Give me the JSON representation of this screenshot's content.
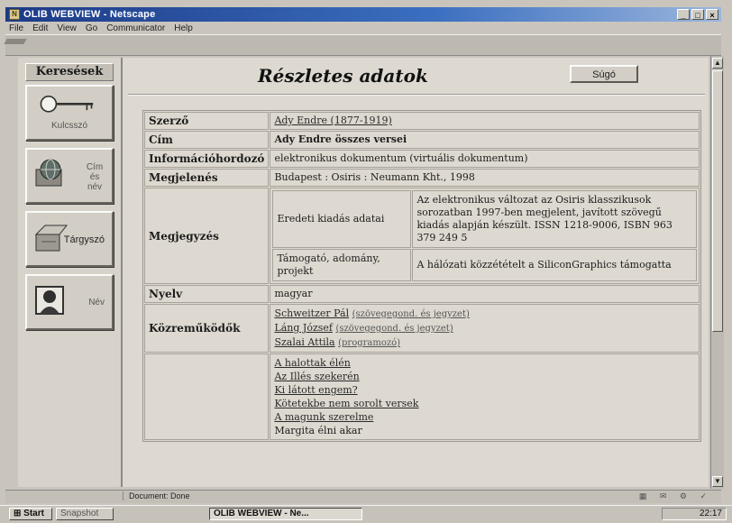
{
  "window": {
    "title": "OLIB WEBVIEW - Netscape",
    "controls": [
      "_",
      "□",
      "×"
    ]
  },
  "menu": [
    "File",
    "Edit",
    "View",
    "Go",
    "Communicator",
    "Help"
  ],
  "sidebar": {
    "heading": "Keresések",
    "items": [
      {
        "label": "Kulcsszó",
        "icon": "key-icon"
      },
      {
        "label": "Cím és név",
        "icon": "globe-book-icon"
      },
      {
        "label": "Tárgyszó",
        "icon": "open-box-icon"
      },
      {
        "label": "Név",
        "icon": "portrait-icon"
      }
    ]
  },
  "main": {
    "title": "Részletes adatok",
    "help_button": "Súgó",
    "rows": {
      "author": {
        "key": "Szerző",
        "value": "Ady Endre (1877-1919)"
      },
      "title": {
        "key": "Cím",
        "value": "Ady Endre összes versei"
      },
      "medium": {
        "key": "Információhordozó",
        "value": "elektronikus dokumentum (virtuális dokumentum)"
      },
      "published": {
        "key": "Megjelenés",
        "value": "Budapest : Osiris : Neumann Kht., 1998"
      },
      "note": {
        "key": "Megjegyzés",
        "entries": [
          {
            "label": "Eredeti kiadás adatai",
            "value": "Az elektronikus változat az Osiris klasszikusok sorozatban 1997-ben megjelent, javított szövegű kiadás alapján készült. ISSN 1218-9006, ISBN 963 379 249 5"
          },
          {
            "label": "Támogató, adomány, projekt",
            "value": "A hálózati közzétételt a SiliconGraphics támogatta"
          }
        ]
      },
      "language": {
        "key": "Nyelv",
        "value": "magyar"
      },
      "contributors": {
        "key": "Közreműködők",
        "items": [
          {
            "name": "Schweitzer Pál",
            "role": "(szövegegond. és jegyzet)"
          },
          {
            "name": "Láng József",
            "role": "(szövegegond. és jegyzet)"
          },
          {
            "name": "Szalai Attila",
            "role": "(programozó)"
          }
        ]
      },
      "contents": {
        "items": [
          "A halottak élén",
          "Az Illés szekerén",
          "Ki látott engem?",
          "Kötetekbe nem sorolt versek",
          "A magunk szerelme",
          "Margita élni akar"
        ]
      }
    }
  },
  "statusbar": {
    "text": "Document: Done"
  },
  "taskbar": {
    "start": "Start",
    "quick": "Snapshot",
    "task": "OLIB WEBVIEW - Ne...",
    "clock": "22:17"
  },
  "colors": {
    "titlebar": "#1c3a86",
    "page_bg": "#ddd9d0",
    "chrome": "#c9c5bd"
  }
}
